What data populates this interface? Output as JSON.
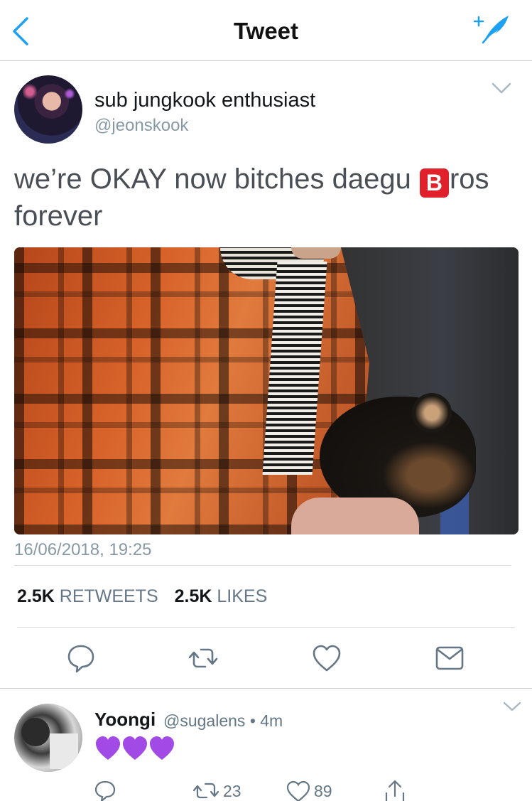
{
  "navbar": {
    "title": "Tweet",
    "back_icon": "chevron-left-icon",
    "compose_icon": "compose-quill-icon",
    "accent": "#1da1f2"
  },
  "tweet": {
    "author_name": "sub jungkook enthusiast",
    "author_handle": "@jeonskook",
    "text_before": "we’re OKAY now bitches daegu ",
    "emoji_letter": "B",
    "text_after": "ros forever",
    "emoji_color": "#e0202a",
    "timestamp": "16/06/2018, 19:25",
    "stats": {
      "retweets_count": "2.5K",
      "retweets_label": "RETWEETS",
      "likes_count": "2.5K",
      "likes_label": "LIKES"
    },
    "actions": [
      "reply-icon",
      "retweet-icon",
      "like-icon",
      "direct-message-icon"
    ]
  },
  "reply": {
    "name": "Yoongi",
    "handle": "@sugalens",
    "separator": "•",
    "age": "4m",
    "hearts_count": 3,
    "heart_color": "#a24ae6",
    "retweets": "23",
    "likes": "89",
    "actions": [
      "reply-icon",
      "retweet-icon",
      "like-icon",
      "share-icon"
    ]
  }
}
